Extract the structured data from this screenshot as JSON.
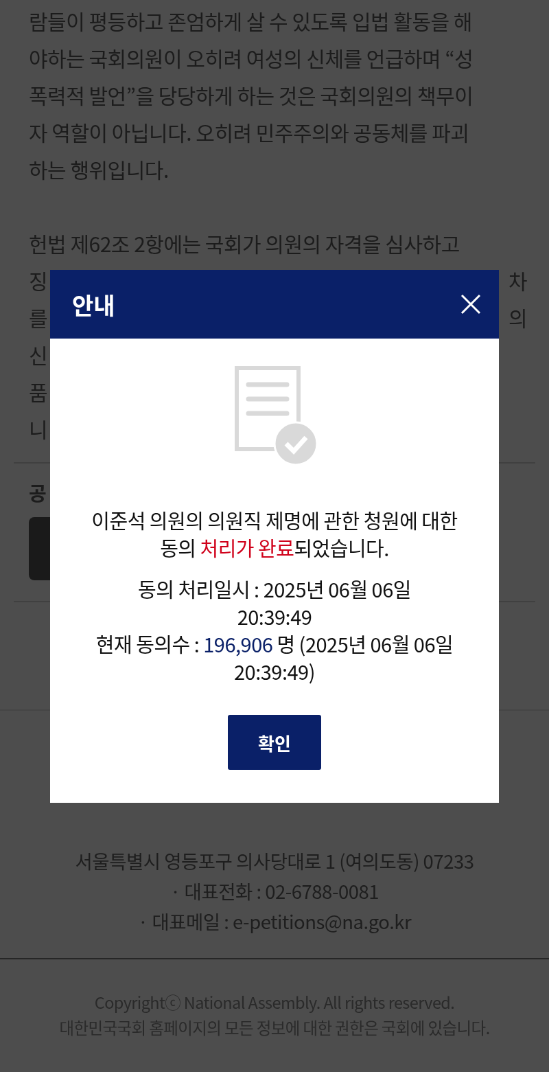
{
  "article": {
    "lines": [
      {
        "text": "람들이 평등하고 존엄하게 살 수 있도록 입법 활동을 해"
      },
      {
        "text": "야하는 국회의원이 오히려 여성의 신체를 언급하며 “성"
      },
      {
        "text": "폭력적 발언”을 당당하게 하는 것은 국회의원의 책무이"
      },
      {
        "text": "자 역할이 아닙니다. 오히려 민주주의와 공동체를 파괴"
      },
      {
        "text": "하는 행위입니다."
      },
      {
        "kind": "gap"
      },
      {
        "text": "헌법 제62조 2항에는 국회가 의원의 자격을 심사하고"
      },
      {
        "left": "징",
        "right": "차"
      },
      {
        "left": "를",
        "right": "의"
      },
      {
        "left": "신"
      },
      {
        "left": "품"
      },
      {
        "left": "니"
      }
    ]
  },
  "share": {
    "heading": "공"
  },
  "dialog": {
    "title": "안내",
    "message": [
      {
        "kind": "plain",
        "text": "이준석 의원의 의원직 제명에 관한 청원에 대한 동의 "
      },
      {
        "kind": "alert",
        "text": "처리가 완료"
      },
      {
        "kind": "plain",
        "text": "되었습니다."
      }
    ],
    "date": "동의 처리일시 : 2025년 06월 06일 20:39:49",
    "count": [
      {
        "kind": "plain",
        "text": "현재 동의수 : "
      },
      {
        "kind": "number",
        "text": "196,906"
      },
      {
        "kind": "plain",
        "text": " 명 (2025년 06월 06일 20:39:49)"
      }
    ],
    "button": "확인"
  },
  "footer": {
    "address": [
      "서울특별시 영등포구 의사당대로 1 (여의도동) 07233",
      "· 대표전화 : 02-6788-0081",
      "· 대표메일 : e-petitions@na.go.kr"
    ],
    "copyright": [
      "Copyrightⓒ National Assembly. All rights reserved.",
      "대한민국국회 홈페이지의 모든 정보에 대한 권한은 국회에 있습니다."
    ]
  }
}
